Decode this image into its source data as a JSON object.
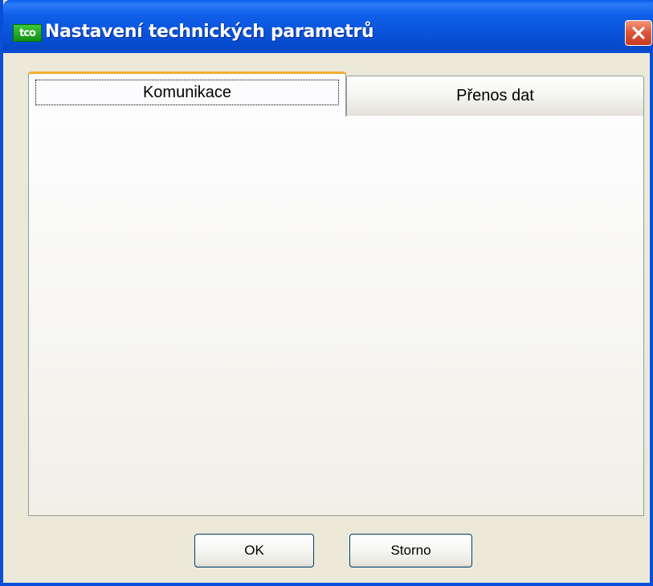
{
  "window": {
    "title": "Nastavení technických parametrů",
    "app_icon_text": "tco",
    "close_icon": "close-x-icon"
  },
  "tabs": [
    {
      "label": "Komunikace",
      "active": true
    },
    {
      "label": "Přenos dat",
      "active": false
    }
  ],
  "buttons": {
    "ok_label": "OK",
    "cancel_label": "Storno"
  },
  "colors": {
    "titlebar": "#0a5de8",
    "window_bg": "#ece9d8",
    "active_tab_accent": "#f0b030",
    "close_button": "#e0573a"
  }
}
